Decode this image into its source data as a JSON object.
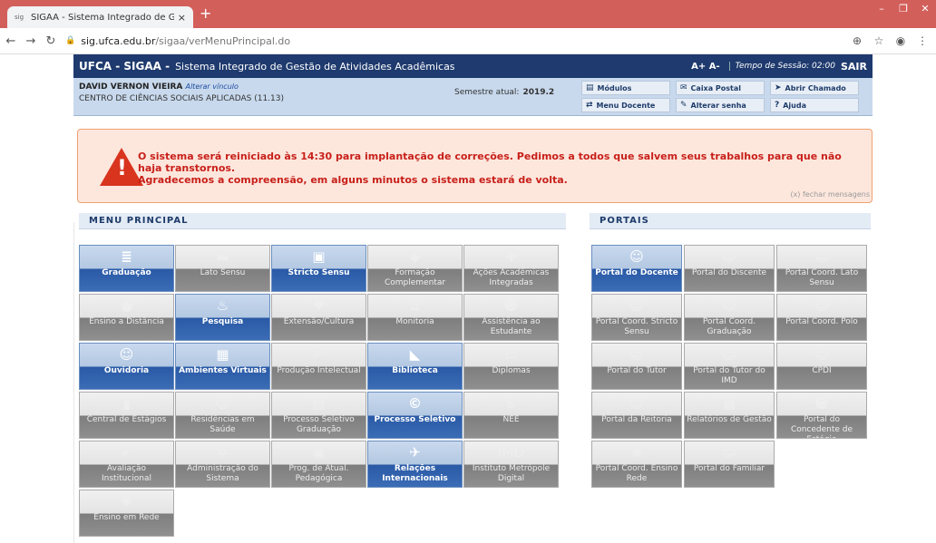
{
  "browser": {
    "tab_title": "SIGAA - Sistema Integrado de Ge",
    "tab_close": "×",
    "new_tab": "+",
    "url_host": "sig.ufca.edu.br",
    "url_path": "/sigaa/verMenuPrincipal.do",
    "fav": "sig"
  },
  "header": {
    "brand": "UFCA - SIGAA -",
    "subtitle": "Sistema Integrado de Gestão de Atividades Acadêmicas",
    "font_ctrl": "A+ A-",
    "session": "Tempo de Sessão: 02:00",
    "logout": "SAIR"
  },
  "user": {
    "name": "DAVID VERNON VIEIRA",
    "change_link": "Alterar vínculo",
    "centro": "CENTRO DE CIÊNCIAS SOCIAIS APLICADAS (11.13)",
    "semester_label": "Semestre atual:",
    "semester": "2019.2"
  },
  "quick": [
    {
      "icon": "▤",
      "label": "Módulos"
    },
    {
      "icon": "✉",
      "label": "Caixa Postal"
    },
    {
      "icon": "➤",
      "label": "Abrir Chamado"
    },
    {
      "icon": "⇄",
      "label": "Menu Docente"
    },
    {
      "icon": "✎",
      "label": "Alterar senha"
    },
    {
      "icon": "?",
      "label": "Ajuda"
    }
  ],
  "alert": {
    "line1": "O sistema será reiniciado às 14:30 para implantação de correções. Pedimos a todos que salvem seus trabalhos para que não haja transtornos.",
    "line2": "Agradecemos a compreensão, em alguns minutos o sistema estará de volta.",
    "close": "(x) fechar mensagens"
  },
  "menu_title": "MENU PRINCIPAL",
  "portals_title": "PORTAIS",
  "menu": [
    {
      "label": "Graduação",
      "on": true,
      "icon": "≣"
    },
    {
      "label": "Lato Sensu",
      "on": false,
      "icon": "▬"
    },
    {
      "label": "Stricto Sensu",
      "on": true,
      "icon": "▣"
    },
    {
      "label": "Formação Complementar",
      "on": false,
      "icon": "◆"
    },
    {
      "label": "Ações Acadêmicas Integradas",
      "on": false,
      "icon": "✤"
    },
    {
      "label": "Ensino a Distância",
      "on": false,
      "icon": "●"
    },
    {
      "label": "Pesquisa",
      "on": true,
      "icon": "♨"
    },
    {
      "label": "Extensão/Cultura",
      "on": false,
      "icon": "♥"
    },
    {
      "label": "Monitoria",
      "on": false,
      "icon": "⌂"
    },
    {
      "label": "Assistência ao Estudante",
      "on": false,
      "icon": "☻"
    },
    {
      "label": "Ouvidoria",
      "on": true,
      "icon": "☺"
    },
    {
      "label": "Ambientes Virtuais",
      "on": true,
      "icon": "▦"
    },
    {
      "label": "Produção Intelectual",
      "on": false,
      "icon": "✍"
    },
    {
      "label": "Biblioteca",
      "on": true,
      "icon": "◣"
    },
    {
      "label": "Diplomas",
      "on": false,
      "icon": "▭"
    },
    {
      "label": "Central de Estágios",
      "on": false,
      "icon": "▮"
    },
    {
      "label": "Residências em Saúde",
      "on": false,
      "icon": "☺"
    },
    {
      "label": "Processo Seletivo Graduação",
      "on": false,
      "icon": "▤"
    },
    {
      "label": "Processo Seletivo",
      "on": true,
      "icon": "©"
    },
    {
      "label": "NEE",
      "on": false,
      "icon": "♿"
    },
    {
      "label": "Avaliação Institucional",
      "on": false,
      "icon": "✔"
    },
    {
      "label": "Administração do Sistema",
      "on": false,
      "icon": "✲"
    },
    {
      "label": "Prog. de Atual. Pedagógica",
      "on": false,
      "icon": "▣"
    },
    {
      "label": "Relações Internacionais",
      "on": true,
      "icon": "✈"
    },
    {
      "label": "Instituto Metrópole Digital",
      "on": false,
      "icon": "IMD"
    },
    {
      "label": "Ensino em Rede",
      "on": false,
      "icon": "✺"
    }
  ],
  "portals": [
    {
      "label": "Portal do Docente",
      "on": true,
      "icon": "☺"
    },
    {
      "label": "Portal do Discente",
      "on": false,
      "icon": "☺"
    },
    {
      "label": "Portal Coord. Lato Sensu",
      "on": false,
      "icon": "☺"
    },
    {
      "label": "Portal Coord. Stricto Sensu",
      "on": false,
      "icon": "☺"
    },
    {
      "label": "Portal Coord. Graduação",
      "on": false,
      "icon": "☺"
    },
    {
      "label": "Portal Coord. Polo",
      "on": false,
      "icon": "☺"
    },
    {
      "label": "Portal do Tutor",
      "on": false,
      "icon": "☺"
    },
    {
      "label": "Portal do Tutor do IMD",
      "on": false,
      "icon": "☺"
    },
    {
      "label": "CPDI",
      "on": false,
      "icon": "☺"
    },
    {
      "label": "Portal da Reitoria",
      "on": false,
      "icon": "☺"
    },
    {
      "label": "Relatórios de Gestão",
      "on": false,
      "icon": "▦"
    },
    {
      "label": "Portal do Concedente de Estágio",
      "on": false,
      "icon": "☻"
    },
    {
      "label": "Portal Coord. Ensino Rede",
      "on": false,
      "icon": "✺"
    },
    {
      "label": "Portal do Familiar",
      "on": false,
      "icon": "☺"
    }
  ]
}
